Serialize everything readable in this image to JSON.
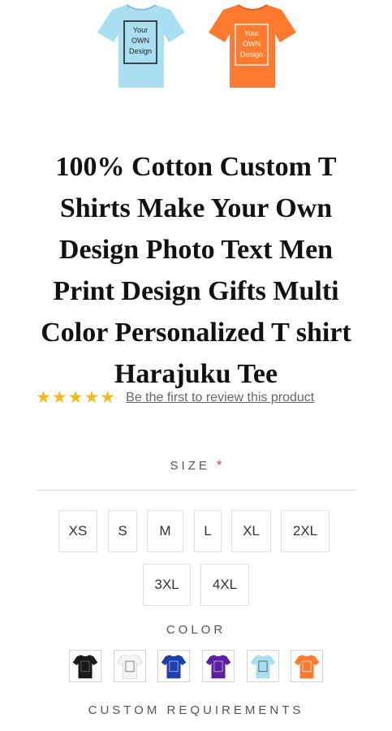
{
  "hero": {
    "images": [
      {
        "color": "#a9dff0",
        "print_lines": [
          "Your",
          "OWN",
          "Design"
        ],
        "print_color": "#222"
      },
      {
        "color": "#ff7a2e",
        "print_lines": [
          "Your",
          "OWN",
          "Design"
        ],
        "print_color": "#ffffff"
      }
    ]
  },
  "product": {
    "title_lines": [
      "100% Cotton Custom T",
      "Shirts Make Your Own",
      "Design Photo Text Men",
      "Print Design Gifts Multi",
      "Color Personalized T shirt",
      "Harajuku Tee"
    ],
    "rating": {
      "stars": "★★★★★",
      "star_color": "#f3b91b",
      "review_link": "Be the first to review this product"
    }
  },
  "size": {
    "label": "SIZE",
    "required_mark": "*",
    "options": [
      "XS",
      "S",
      "M",
      "L",
      "XL",
      "2XL",
      "3XL",
      "4XL"
    ]
  },
  "color": {
    "label": "COLOR",
    "swatches": [
      {
        "name": "black",
        "hex": "#1a1a1a"
      },
      {
        "name": "white",
        "hex": "#f4f4f4"
      },
      {
        "name": "royal-blue",
        "hex": "#1f3fae"
      },
      {
        "name": "purple",
        "hex": "#5b1fa0"
      },
      {
        "name": "light-blue",
        "hex": "#a9dff0"
      },
      {
        "name": "orange",
        "hex": "#ff7a2e"
      }
    ]
  },
  "custom": {
    "label": "CUSTOM REQUIREMENTS"
  }
}
